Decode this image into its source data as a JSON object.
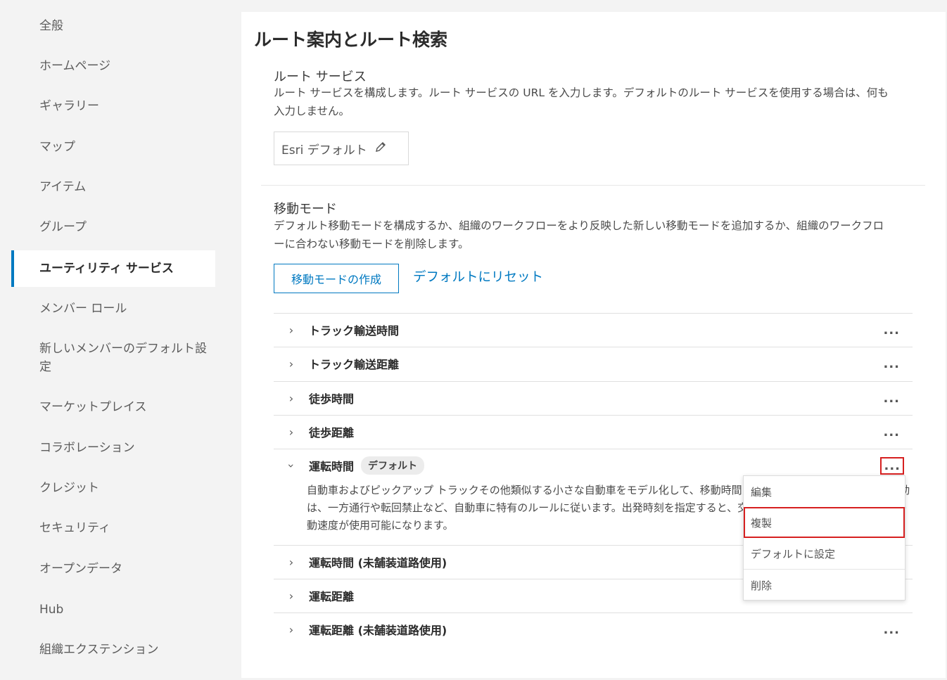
{
  "sidebar": {
    "items": [
      {
        "label": "全般"
      },
      {
        "label": "ホームページ"
      },
      {
        "label": "ギャラリー"
      },
      {
        "label": "マップ"
      },
      {
        "label": "アイテム"
      },
      {
        "label": "グループ"
      },
      {
        "label": "ユーティリティ サービス",
        "active": true
      },
      {
        "label": "メンバー ロール"
      },
      {
        "label": "新しいメンバーのデフォルト設定"
      },
      {
        "label": "マーケットプレイス"
      },
      {
        "label": "コラボレーション"
      },
      {
        "label": "クレジット"
      },
      {
        "label": "セキュリティ"
      },
      {
        "label": "オープンデータ"
      },
      {
        "label": "Hub"
      },
      {
        "label": "組織エクステンション"
      }
    ]
  },
  "main": {
    "title": "ルート案内とルート検索",
    "route_service": {
      "title": "ルート サービス",
      "description": "ルート サービスを構成します。ルート サービスの URL を入力します。デフォルトのルート サービスを使用する場合は、何も入力しません。",
      "current_value": "Esri デフォルト"
    },
    "travel_modes": {
      "title": "移動モード",
      "description": "デフォルト移動モードを構成するか、組織のワークフローをより反映した新しい移動モードを追加するか、組織のワークフローに合わない移動モードを削除します。",
      "create_button": "移動モードの作成",
      "reset_link": "デフォルトにリセット",
      "rows": [
        {
          "label": "トラック輸送時間"
        },
        {
          "label": "トラック輸送距離"
        },
        {
          "label": "徒歩時間"
        },
        {
          "label": "徒歩距離"
        },
        {
          "label": "運転時間",
          "badge": "デフォルト",
          "expanded": true,
          "description": "自動車およびピックアップ トラックその他類似する小さな自動車をモデル化して、移動時間を最適化する解を見つけます。移動は、一方通行や転回禁止など、自動車に特有のルールに従います。出発時刻を指定すると、交通状況に応じて動的に変化する移動速度が使用可能になります。"
        },
        {
          "label": "運転時間 (未舗装道路使用)"
        },
        {
          "label": "運転距離"
        },
        {
          "label": "運転距離 (未舗装道路使用)"
        }
      ],
      "more_symbol": "..."
    }
  },
  "context_menu": {
    "items": [
      {
        "label": "編集"
      },
      {
        "label": "複製",
        "highlighted": true
      },
      {
        "label": "デフォルトに設定"
      },
      {
        "label": "削除"
      }
    ]
  },
  "colors": {
    "accent": "#0079c1",
    "highlight": "#d62020"
  }
}
